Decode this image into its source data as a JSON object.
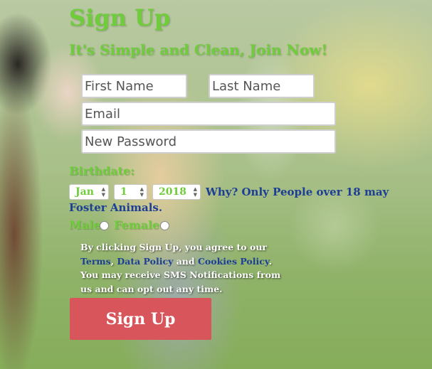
{
  "header": {
    "title": "Sign Up",
    "subtitle": "It's Simple and Clean, Join Now!"
  },
  "form": {
    "first_name_placeholder": "First Name",
    "last_name_placeholder": "Last Name",
    "email_placeholder": "Email",
    "password_placeholder": "New Password",
    "birthdate_label": "Birthdate:",
    "birth_month": "Jan",
    "birth_day": "1",
    "birth_year": "2018",
    "birthdate_note": "Why? Only People over 18 may Foster Animals.",
    "gender_male_label": "Male",
    "gender_female_label": "Female"
  },
  "terms": {
    "prefix": "By clicking Sign Up, you agree to our",
    "terms_link": "Terms",
    "separator": ",",
    "data_policy_link": "Data Policy",
    "and_text": "and",
    "cookies_link": "Cookies Policy",
    "period": ".",
    "sms_text": "You may receive SMS Notifications from us and can opt out any time."
  },
  "button": {
    "signup_label": "Sign Up"
  },
  "colors": {
    "accent_green": "#6fcc3a",
    "link_blue": "#1c3f95",
    "button_red": "#d9555c"
  }
}
